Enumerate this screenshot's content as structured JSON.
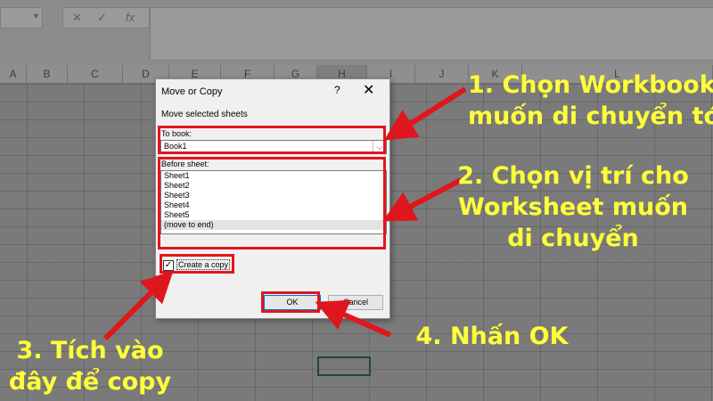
{
  "excel": {
    "fx_label": "fx",
    "cancel_symbol": "✕",
    "enter_symbol": "✓",
    "columns": [
      "A",
      "B",
      "C",
      "D",
      "E",
      "F",
      "G",
      "H",
      "I",
      "J",
      "K",
      "L"
    ]
  },
  "dialog": {
    "title": "Move or Copy",
    "help": "?",
    "close": "✕",
    "subtitle": "Move selected sheets",
    "to_book_label": "To book:",
    "to_book_value": "Book1",
    "before_sheet_label": "Before sheet:",
    "sheets": [
      "Sheet1",
      "Sheet2",
      "Sheet3",
      "Sheet4",
      "Sheet5",
      "(move to end)"
    ],
    "selected_sheet": "(move to end)",
    "create_copy_label": "Create a copy",
    "create_copy_checked": true,
    "ok_label": "OK",
    "cancel_label": "Cancel"
  },
  "annotations": {
    "step1_line1": "1. Chọn Workbook",
    "step1_line2": "muốn di chuyển tới",
    "step2_line1": "2. Chọn vị trí cho",
    "step2_line2": "Worksheet muốn",
    "step2_line3": "di chuyển",
    "step3_line1": "3. Tích vào",
    "step3_line2": "đây để copy",
    "step4": "4. Nhấn OK",
    "highlight_color": "#e0161e",
    "text_color": "#ffff3a"
  }
}
